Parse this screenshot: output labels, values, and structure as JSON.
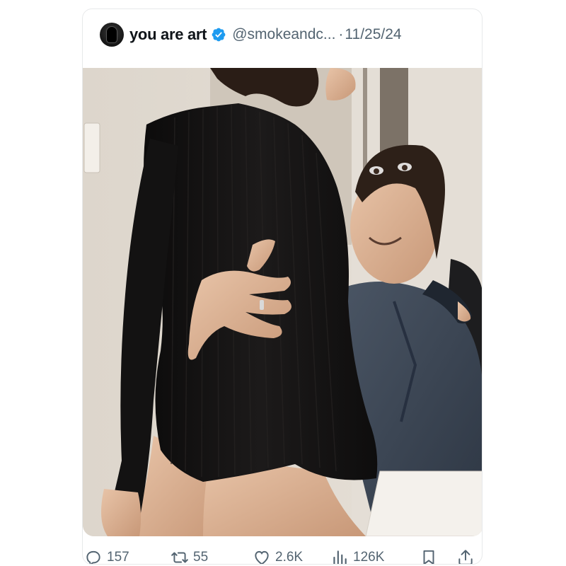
{
  "tweet": {
    "display_name": "you are art",
    "handle": "@smokeandc...",
    "separator": "·",
    "date": "11/25/24",
    "verified": true,
    "avatar_icon": "avatar-icon",
    "verified_icon": "verified-badge-icon",
    "accent_color": "#1d9bf0"
  },
  "actions": {
    "replies": {
      "icon": "reply-icon",
      "count": "157"
    },
    "retweets": {
      "icon": "retweet-icon",
      "count": "55"
    },
    "likes": {
      "icon": "heart-icon",
      "count": "2.6K"
    },
    "views": {
      "icon": "views-chart-icon",
      "count": "126K"
    },
    "bookmark": {
      "icon": "bookmark-icon"
    },
    "share": {
      "icon": "share-icon"
    }
  }
}
